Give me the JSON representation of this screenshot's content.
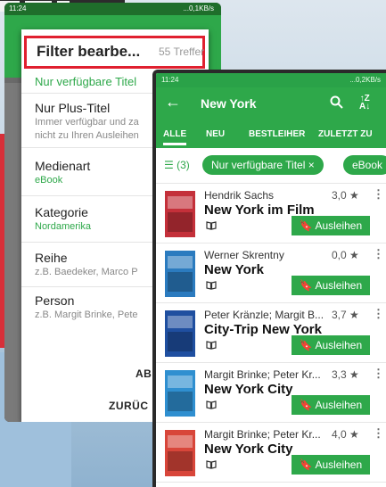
{
  "phoneA": {
    "time": "11:24",
    "net": "...0,1KB/s",
    "dialog": {
      "title": "Filter bearbe...",
      "count": "55 Treffer",
      "selected": "Nur verfügbare Titel",
      "items": [
        {
          "label": "Nur Plus-Titel",
          "sub1": "Immer verfügbar und za",
          "sub2": "nicht zu Ihren Ausleihen"
        },
        {
          "label": "Medienart",
          "value": "eBook"
        },
        {
          "label": "Kategorie",
          "value": "Nordamerika"
        },
        {
          "label": "Reihe",
          "sub1": "z.B. Baedeker, Marco P"
        },
        {
          "label": "Person",
          "sub1": "z.B. Margit Brinke, Pete"
        }
      ],
      "btn_abort": "ABB",
      "btn_reset": "ZURÜC"
    }
  },
  "phoneB": {
    "time": "11:24",
    "net": "...0,2KB/s",
    "title": "New York",
    "tabs": [
      "ALLE",
      "NEU",
      "BESTLEIHER",
      "ZULETZT ZU"
    ],
    "filter_count": "(3)",
    "chips": [
      "Nur verfügbare Titel ×",
      "eBook"
    ],
    "books": [
      {
        "author": "Hendrik Sachs",
        "rating": "3,0 ★",
        "title": "New York im Film",
        "loan": "Ausleihen",
        "color": "#c4303a"
      },
      {
        "author": "Werner Skrentny",
        "rating": "0,0 ★",
        "title": "New York",
        "loan": "Ausleihen",
        "color": "#2b7bbf"
      },
      {
        "author": "Peter Kränzle; Margit B...",
        "rating": "3,7 ★",
        "title": "City-Trip New York",
        "loan": "Ausleihen",
        "color": "#1f4fa0"
      },
      {
        "author": "Margit Brinke; Peter Kr...",
        "rating": "3,3 ★",
        "title": "New York City",
        "loan": "Ausleihen",
        "color": "#2f8fd0"
      },
      {
        "author": "Margit Brinke; Peter Kr...",
        "rating": "4,0 ★",
        "title": "New York City",
        "loan": "Ausleihen",
        "color": "#d8463a"
      }
    ]
  },
  "colors": {
    "green": "#2ea84a",
    "red": "#e0202f"
  }
}
